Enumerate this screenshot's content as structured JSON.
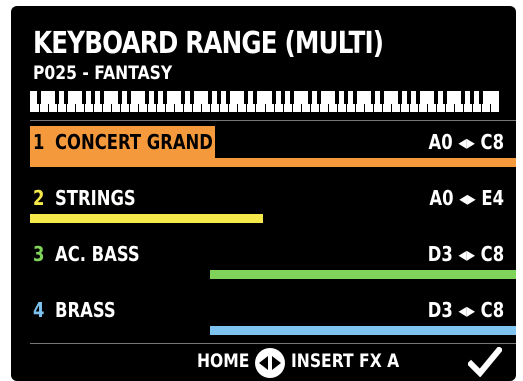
{
  "header": {
    "title": "KEYBOARD RANGE (MULTI)",
    "preset": "P025 - FANTASY"
  },
  "zones": [
    {
      "number": "1",
      "name": "CONCERT GRAND",
      "low": "A0",
      "high": "C8",
      "range_label": "A0 ◂▸ C8",
      "color": "#f59a3c",
      "selected": true,
      "bar_fraction": [
        0.0,
        1.0
      ]
    },
    {
      "number": "2",
      "name": "STRINGS",
      "low": "A0",
      "high": "E4",
      "range_label": "A0 ◂▸ E4",
      "color": "#f5e84a",
      "selected": false,
      "bar_fraction": [
        0.0,
        0.48
      ]
    },
    {
      "number": "3",
      "name": "AC. BASS",
      "low": "D3",
      "high": "C8",
      "range_label": "D3 ◂▸ C8",
      "color": "#7fd35a",
      "selected": false,
      "bar_fraction": [
        0.37,
        1.0
      ]
    },
    {
      "number": "4",
      "name": "BRASS",
      "low": "D3",
      "high": "C8",
      "range_label": "D3 ◂▸ C8",
      "color": "#7ec3f0",
      "selected": false,
      "bar_fraction": [
        0.37,
        1.0
      ]
    }
  ],
  "footer": {
    "home_label": "HOME",
    "insert_label": "INSERT FX A",
    "nav_icon": "left-right-circle-icon",
    "confirm_icon": "checkmark-icon"
  },
  "colors": {
    "background": "#000000",
    "text": "#ffffff",
    "selected_text": "#000000"
  }
}
